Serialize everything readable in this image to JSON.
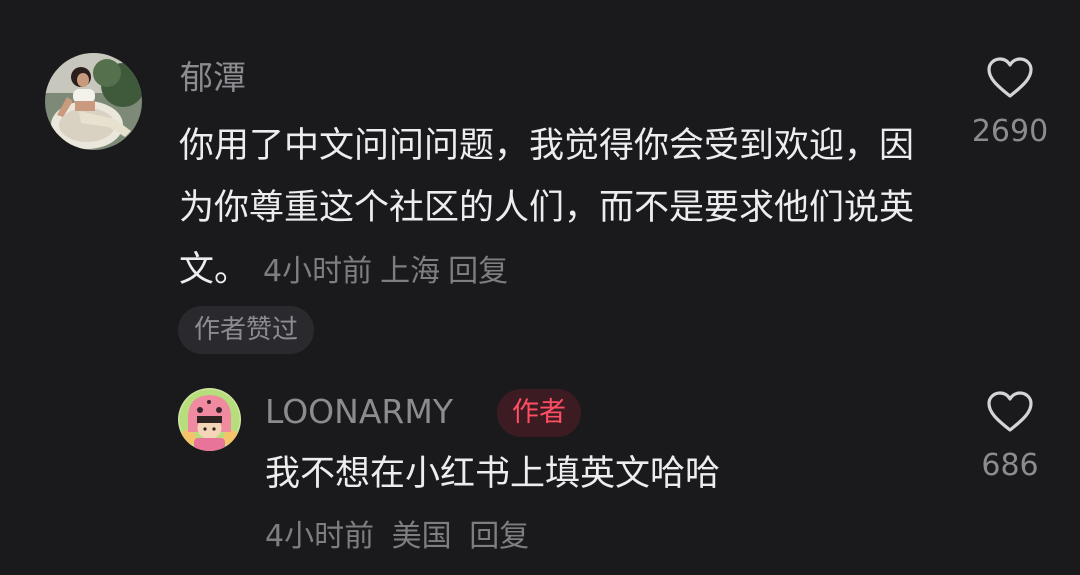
{
  "comment": {
    "username": "郁潭",
    "text": "你用了中文问问问题，我觉得你会受到欢迎，因为你尊重这个社区的人们，而不是要求他们说英文。",
    "time": "4小时前",
    "location": "上海",
    "reply_label": "回复",
    "author_liked_label": "作者赞过",
    "like_count": "2690",
    "like_icon": "heart-outline-icon"
  },
  "reply": {
    "username": "LOONARMY",
    "badge": "作者",
    "text": "我不想在小红书上填英文哈哈",
    "time": "4小时前",
    "location": "美国",
    "reply_label": "回复",
    "like_count": "686",
    "like_icon": "heart-outline-icon"
  },
  "colors": {
    "background": "#1a1a1d",
    "primary_text": "#ededee",
    "secondary_text": "#8b8b90",
    "badge_text": "#ff4e63",
    "badge_bg": "#3c1c22",
    "chip_bg": "#2a2a2e"
  }
}
